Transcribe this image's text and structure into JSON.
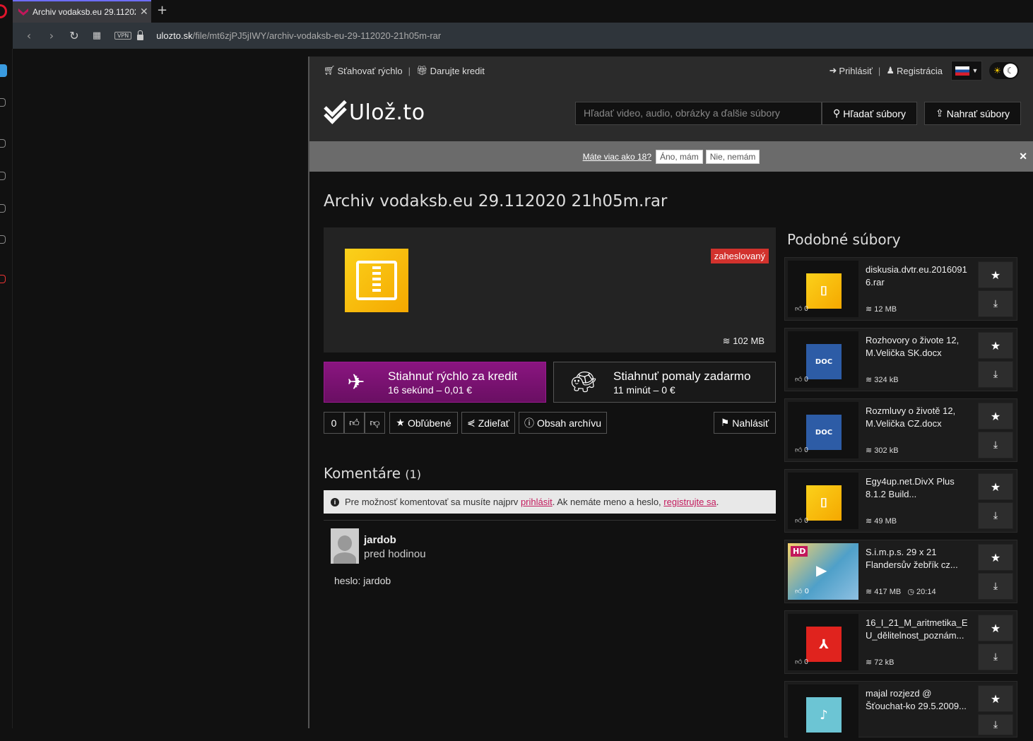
{
  "browser": {
    "tab_title": "Archiv vodaksb.eu 29.112020 21h05m.rar",
    "url_domain": "ulozto.sk",
    "url_path": "/file/mt6zjPJ5jIWY/archiv-vodaksb-eu-29-112020-21h05m-rar",
    "vpn_label": "VPN"
  },
  "topbar": {
    "fast_download": "Sťahovať rýchlo",
    "donate_credit": "Darujte kredit",
    "login": "Prihlásiť",
    "register": "Registrácia"
  },
  "header": {
    "logo_text": "Ulož.to",
    "search_placeholder": "Hľadať video, audio, obrázky a ďalšie súbory",
    "search_button": "Hľadať súbory",
    "upload_button": "Nahrať súbory"
  },
  "age_gate": {
    "question": "Máte viac ako 18?",
    "yes": "Áno, mám",
    "no": "Nie, nemám"
  },
  "file": {
    "title": "Archiv vodaksb.eu 29.112020 21h05m.rar",
    "badge": "zaheslovaný",
    "size": "102 MB"
  },
  "download": {
    "fast_title": "Stiahnuť rýchlo za kredit",
    "fast_sub": "16 sekúnd – 0,01 €",
    "slow_title": "Stiahnuť pomaly zadarmo",
    "slow_sub": "11 minút – 0 €"
  },
  "actions": {
    "rating": "0",
    "favorite": "Obľúbené",
    "share": "Zdieľať",
    "archive_contents": "Obsah archívu",
    "report": "Nahlásiť"
  },
  "comments": {
    "title": "Komentáre",
    "count": "(1)",
    "notice_prefix": "Pre možnosť komentovať sa musíte najprv",
    "notice_login": "prihlásit",
    "notice_middle": ". Ak nemáte meno a heslo,",
    "notice_register": "registrujte sa",
    "notice_suffix": ".",
    "items": [
      {
        "user": "jardob",
        "time": "pred hodinou",
        "text": "heslo: jardob"
      }
    ]
  },
  "similar": {
    "title": "Podobné súbory",
    "items": [
      {
        "name": "diskusia.dvtr.eu.20160916.rar",
        "size": "12 MB",
        "likes": "0",
        "type": "zip"
      },
      {
        "name": "Rozhovory o živote 12, M.Velička SK.docx",
        "size": "324 kB",
        "likes": "0",
        "type": "doc"
      },
      {
        "name": "Rozmluvy o životě 12, M.Velička CZ.docx",
        "size": "302 kB",
        "likes": "0",
        "type": "doc"
      },
      {
        "name": "Egy4up.net.DivX Plus 8.1.2 Build...",
        "size": "49 MB",
        "likes": "0",
        "type": "zip"
      },
      {
        "name": "S.i.m.p.s. 29 x 21 Flandersův žebřík cz...",
        "size": "417 MB",
        "duration": "20:14",
        "likes": "0",
        "type": "video",
        "hd": "HD"
      },
      {
        "name": "16_I_21_M_aritmetika_EU_dělitelnost_poznám...",
        "size": "72 kB",
        "likes": "0",
        "type": "pdf"
      },
      {
        "name": "majal rozjezd @ Šťouchat-ko 29.5.2009...",
        "size": "",
        "likes": "0",
        "type": "audio"
      }
    ]
  }
}
